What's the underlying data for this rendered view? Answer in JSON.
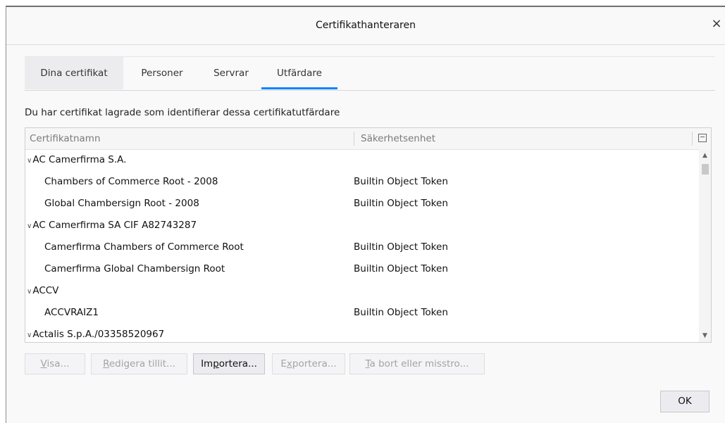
{
  "window": {
    "title": "Certifikathanteraren"
  },
  "tabs": [
    {
      "label": "Dina certifikat"
    },
    {
      "label": "Personer"
    },
    {
      "label": "Servrar"
    },
    {
      "label": "Utfärdare"
    }
  ],
  "description": "Du har certifikat lagrade som identifierar dessa certifikatutfärdare",
  "tree": {
    "headers": {
      "name": "Certifikatnamn",
      "device": "Säkerhetsenhet"
    },
    "rows": [
      {
        "name": "AC Camerfirma S.A.",
        "device": "",
        "group": true
      },
      {
        "name": "Chambers of Commerce Root - 2008",
        "device": "Builtin Object Token",
        "group": false
      },
      {
        "name": "Global Chambersign Root - 2008",
        "device": "Builtin Object Token",
        "group": false
      },
      {
        "name": "AC Camerfirma SA CIF A82743287",
        "device": "",
        "group": true
      },
      {
        "name": "Camerfirma Chambers of Commerce Root",
        "device": "Builtin Object Token",
        "group": false
      },
      {
        "name": "Camerfirma Global Chambersign Root",
        "device": "Builtin Object Token",
        "group": false
      },
      {
        "name": "ACCV",
        "device": "",
        "group": true
      },
      {
        "name": "ACCVRAIZ1",
        "device": "Builtin Object Token",
        "group": false
      },
      {
        "name": "Actalis S.p.A./03358520967",
        "device": "",
        "group": true
      }
    ]
  },
  "buttons": {
    "view": {
      "access": "V",
      "rest": "isa..."
    },
    "edit": {
      "access": "R",
      "rest": "edigera tillit..."
    },
    "import": {
      "pre": "Im",
      "access": "p",
      "rest": "ortera..."
    },
    "export": {
      "pre": "E",
      "access": "x",
      "rest": "portera..."
    },
    "delete": {
      "access": "T",
      "rest": "a bort eller misstro..."
    },
    "ok": "OK"
  },
  "icons": {
    "close": "close-icon",
    "collapse": "chevron-down-icon",
    "column_picker": "column-picker-icon"
  }
}
